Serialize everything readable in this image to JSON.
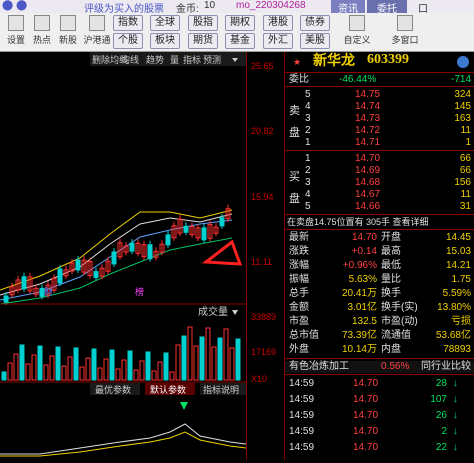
{
  "title": {
    "left": "评级为买入的股票",
    "s1": "金币:",
    "s2": "10",
    "s3": "mo_220304268",
    "tab1": "资讯",
    "tab2": "委托",
    "close": "口"
  },
  "toolbar": {
    "left": [
      "设置",
      "热点",
      "新股",
      "沪港通"
    ],
    "buttons": [
      "指数",
      "全球",
      "股指",
      "期权",
      "港股",
      "债券",
      "个股",
      "板块",
      "期货",
      "基金",
      "外汇",
      "美股"
    ],
    "right": [
      "自定义",
      "多窗口"
    ]
  },
  "chart": {
    "top": [
      "删除均线",
      "均线",
      "趋势",
      "量",
      "指标",
      "预测"
    ],
    "caijia": "财",
    "bang": "榜",
    "vol_label": "成交量",
    "tabs": [
      "最优参数",
      "默认参数",
      "指标说明"
    ],
    "x10": "X10"
  },
  "axis": {
    "p1": "25.65",
    "p2": "20.82",
    "p3": "15.94",
    "p4": "11.11",
    "v1": "33889",
    "v2": "17169",
    "v3": "X10"
  },
  "quote": {
    "name": "新华龙",
    "code": "603399",
    "wb_label": "委比",
    "wb": "-46.44%",
    "wc": "-714",
    "sell": [
      {
        "n": "5",
        "p": "14.75",
        "v": "324"
      },
      {
        "n": "4",
        "p": "14.74",
        "v": "145"
      },
      {
        "n": "3",
        "p": "14.73",
        "v": "163"
      },
      {
        "n": "2",
        "p": "14.72",
        "v": "11"
      },
      {
        "n": "1",
        "p": "14.71",
        "v": "1"
      }
    ],
    "buy": [
      {
        "n": "1",
        "p": "14.70",
        "v": "66"
      },
      {
        "n": "2",
        "p": "14.69",
        "v": "66"
      },
      {
        "n": "3",
        "p": "14.68",
        "v": "156"
      },
      {
        "n": "4",
        "p": "14.67",
        "v": "11"
      },
      {
        "n": "5",
        "p": "14.66",
        "v": "31"
      }
    ],
    "side_sell": "卖盘",
    "side_buy": "买盘",
    "info": "在卖盘14.75位置有 305手 查看详细",
    "stats": [
      [
        "最新",
        "14.70",
        "开盘",
        "14.45"
      ],
      [
        "涨跌",
        "+0.14",
        "最高",
        "15.03"
      ],
      [
        "涨幅",
        "+0.96%",
        "最低",
        "14.21"
      ],
      [
        "振幅",
        "5.63%",
        "量比",
        "1.75"
      ],
      [
        "总手",
        "20.41万",
        "换手",
        "5.59%"
      ],
      [
        "金额",
        "3.01亿",
        "换手(实)",
        "13.80%"
      ],
      [
        "市盈",
        "132.5",
        "市盈(动)",
        "亏损"
      ],
      [
        "总市值",
        "73.39亿",
        "流通值",
        "53.68亿"
      ],
      [
        "外盘",
        "10.14万",
        "内盘",
        "78893"
      ]
    ],
    "sector": "有色冶炼加工",
    "sector_pct": "0.56%",
    "sector_link": "同行业比较",
    "ticks": [
      {
        "t": "14:59",
        "p": "14.70",
        "v": "28",
        "a": "↓"
      },
      {
        "t": "14:59",
        "p": "14.70",
        "v": "107",
        "a": "↓"
      },
      {
        "t": "14:59",
        "p": "14.70",
        "v": "26",
        "a": "↓"
      },
      {
        "t": "14:59",
        "p": "14.70",
        "v": "2",
        "a": "↓"
      },
      {
        "t": "14:59",
        "p": "14.70",
        "v": "22",
        "a": "↓"
      }
    ]
  }
}
